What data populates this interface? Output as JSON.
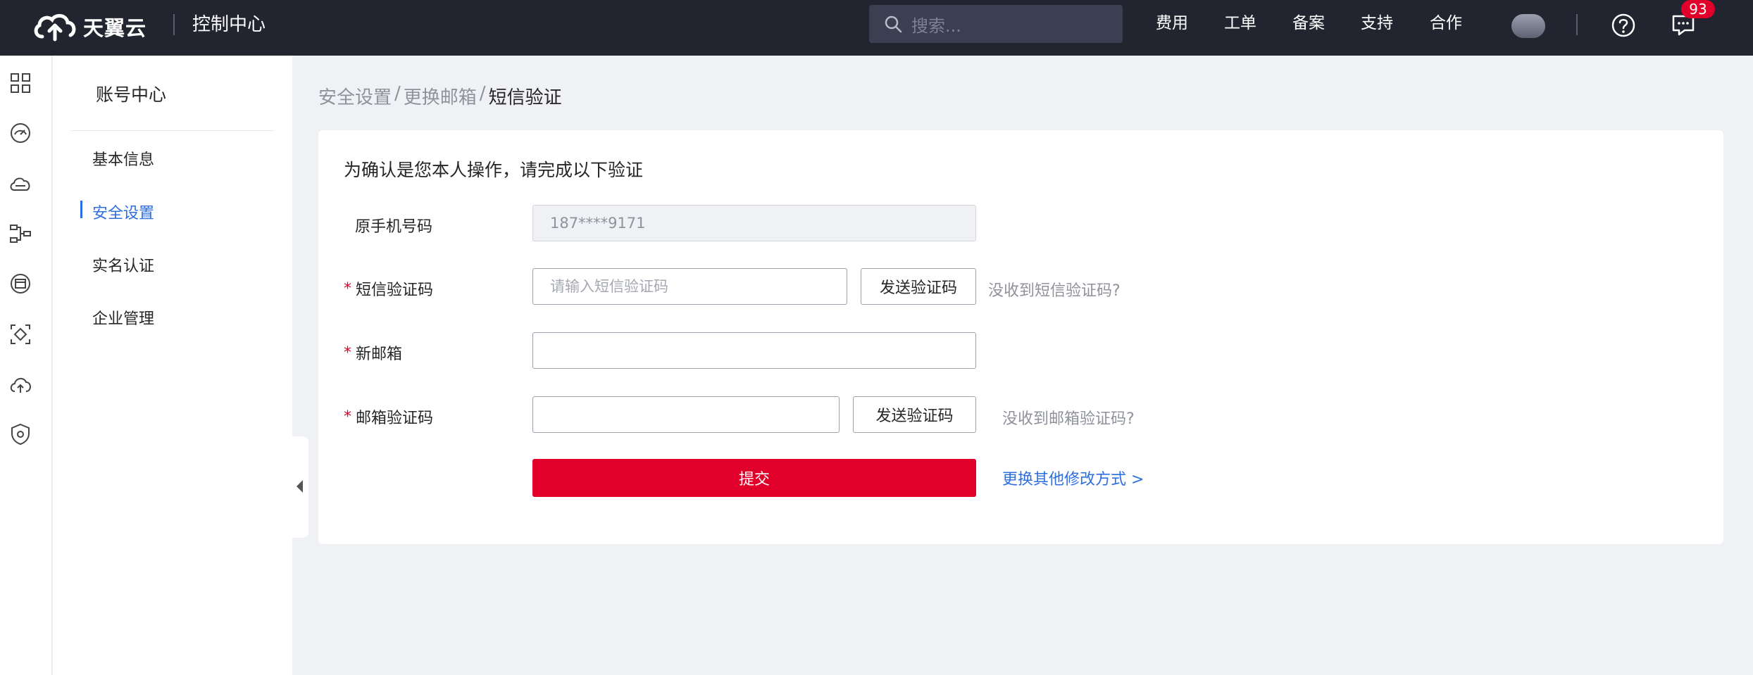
{
  "header": {
    "brand": "天翼云",
    "console_title": "控制中心",
    "search_placeholder": "搜索...",
    "nav": [
      "费用",
      "工单",
      "备案",
      "支持",
      "合作"
    ],
    "message_count": "93"
  },
  "rail_icons": [
    "grid-icon",
    "dashboard-icon",
    "cloud-host-icon",
    "network-icon",
    "storage-icon",
    "scan-icon",
    "cloud-upload-icon",
    "shield-icon"
  ],
  "sidebar": {
    "title": "账号中心",
    "items": [
      {
        "label": "基本信息"
      },
      {
        "label": "安全设置"
      },
      {
        "label": "实名认证"
      },
      {
        "label": "企业管理"
      }
    ],
    "active_item": "安全设置"
  },
  "breadcrumb": {
    "items": [
      "安全设置",
      "更换邮箱",
      "短信验证"
    ],
    "separator": "/"
  },
  "form": {
    "title": "为确认是您本人操作，请完成以下验证",
    "phone_label": "原手机号码",
    "phone_value": "187****9171",
    "sms_label": "短信验证码",
    "sms_placeholder": "请输入短信验证码",
    "sms_send_button": "发送验证码",
    "sms_hint": "没收到短信验证码?",
    "email_label": "新邮箱",
    "email_value": "",
    "email_code_label": "邮箱验证码",
    "email_code_value": "",
    "email_send_button": "发送验证码",
    "email_hint": "没收到邮箱验证码?",
    "required_mark": "*",
    "submit_button": "提交",
    "alt_link": "更换其他修改方式 >"
  },
  "colors": {
    "topbar": "#22242f",
    "accent_red": "#e0002a",
    "link_blue": "#2e6fe0"
  }
}
